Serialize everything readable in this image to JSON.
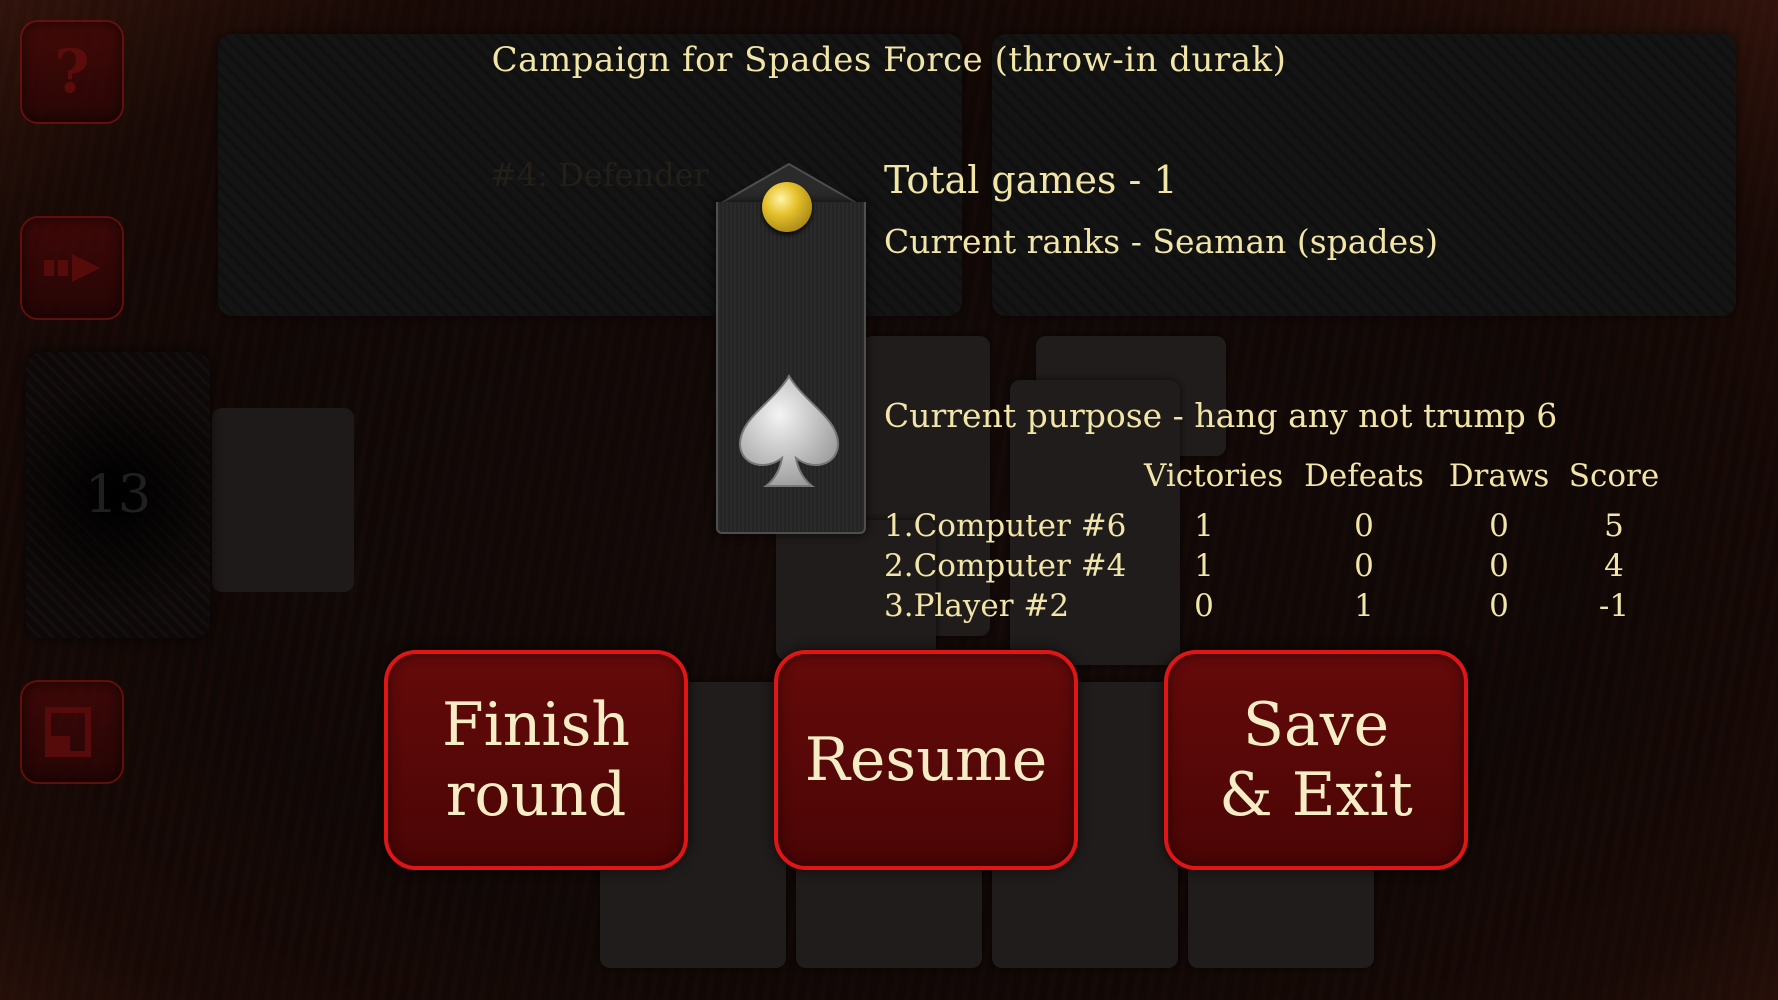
{
  "title": "Campaign for Spades Force (throw-in durak)",
  "opponent_label": "#4: Defender",
  "deck_count": "13",
  "stats": {
    "total_games": "Total games - 1",
    "current_ranks": "Current ranks - Seaman (spades)",
    "current_purpose": "Current purpose - hang any not trump 6"
  },
  "table": {
    "headers": [
      "Victories",
      "Defeats",
      "Draws",
      "Score"
    ],
    "rows": [
      {
        "name": "1.Computer #6",
        "victories": "1",
        "defeats": "0",
        "draws": "0",
        "score": "5"
      },
      {
        "name": "2.Computer #4",
        "victories": "1",
        "defeats": "0",
        "draws": "0",
        "score": "4"
      },
      {
        "name": "3.Player #2",
        "victories": "0",
        "defeats": "1",
        "draws": "0",
        "score": "-1"
      }
    ]
  },
  "buttons": {
    "finish_round": "Finish\nround",
    "resume": "Resume",
    "save_exit": "Save\n& Exit"
  },
  "side_icons": [
    "help-icon",
    "card-sort-icon",
    "exit-door-icon"
  ],
  "card_glyphs": {
    "spade": "♠",
    "club": "♣",
    "heart": "♥",
    "diamond": "♦"
  },
  "colors": {
    "text": "#f1e5a8",
    "button_fill": "#5a0808",
    "button_border": "#e01616",
    "button_text": "#f6edc6"
  }
}
